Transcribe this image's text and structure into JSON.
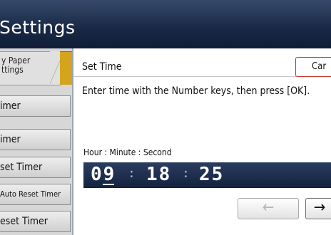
{
  "app": {
    "title": "Settings"
  },
  "tabs": [
    {
      "label": "y Paper\nttings"
    }
  ],
  "sidebar": {
    "items": [
      {
        "label": "imer"
      },
      {
        "label": "imer"
      },
      {
        "label": "set Timer"
      },
      {
        "label": "Auto Reset Timer"
      },
      {
        "label": "eset Timer"
      }
    ]
  },
  "dialog": {
    "title": "Set Time",
    "cancel_label": "Car",
    "instruction": "Enter time with the Number keys, then press [OK].",
    "time_label": "Hour : Minute : Second",
    "time": {
      "hour": "09",
      "minute": "18",
      "second": "25",
      "separator": ":"
    },
    "active_field": "hour",
    "left_arrow": "←",
    "right_arrow": "→"
  },
  "colors": {
    "title_bar": "#1a2a47",
    "active_tab": "#d4a41c",
    "cancel_border": "#c4372b",
    "time_display_bg": "#1c2c4c"
  }
}
